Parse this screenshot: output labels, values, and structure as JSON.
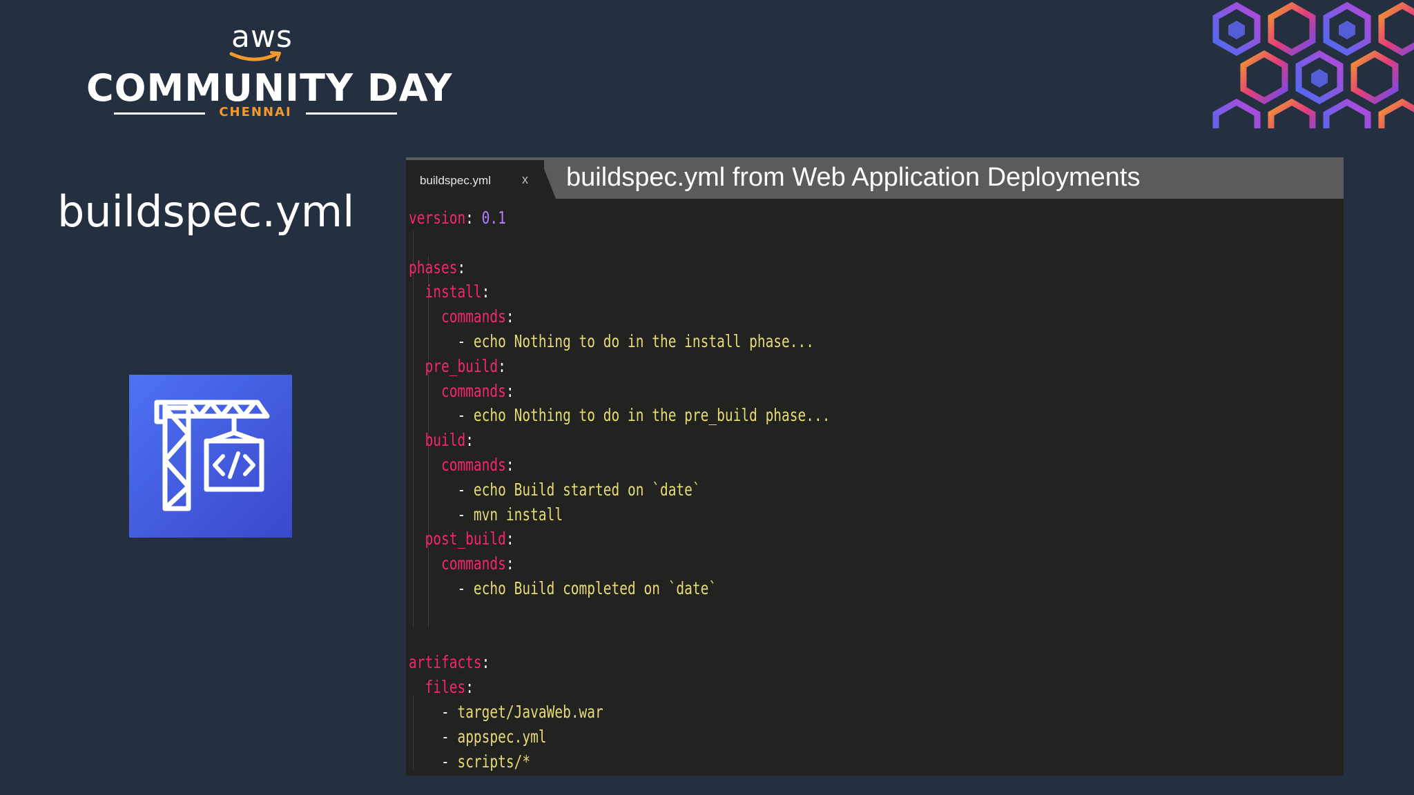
{
  "logo": {
    "aws": "aws",
    "title": "COMMUNITY DAY",
    "city": "CHENNAI"
  },
  "slide_title": "buildspec.yml",
  "service_icon": "codebuild-crane-icon",
  "editor": {
    "tab_label": "buildspec.yml",
    "tab_close": "x",
    "banner": "buildspec.yml from Web Application Deployments",
    "colors": {
      "key": "#f7266c",
      "number": "#ae81ff",
      "string": "#e6db74",
      "punct": "#f8f8f2",
      "background": "#222221"
    },
    "lines": [
      {
        "indent": "",
        "key": "version",
        "sep": ": ",
        "num": "0.1"
      },
      {
        "indent": ""
      },
      {
        "indent": "",
        "key": "phases",
        "sep": ":"
      },
      {
        "indent": "  ",
        "key": "install",
        "sep": ":"
      },
      {
        "indent": "    ",
        "key": "commands",
        "sep": ":"
      },
      {
        "indent": "      ",
        "dash": "- ",
        "val": "echo Nothing to do in the install phase..."
      },
      {
        "indent": "  ",
        "key": "pre_build",
        "sep": ":"
      },
      {
        "indent": "    ",
        "key": "commands",
        "sep": ":"
      },
      {
        "indent": "      ",
        "dash": "- ",
        "val": "echo Nothing to do in the pre_build phase..."
      },
      {
        "indent": "  ",
        "key": "build",
        "sep": ":"
      },
      {
        "indent": "    ",
        "key": "commands",
        "sep": ":"
      },
      {
        "indent": "      ",
        "dash": "- ",
        "val": "echo Build started on `date`"
      },
      {
        "indent": "      ",
        "dash": "- ",
        "val": "mvn install"
      },
      {
        "indent": "  ",
        "key": "post_build",
        "sep": ":"
      },
      {
        "indent": "    ",
        "key": "commands",
        "sep": ":"
      },
      {
        "indent": "      ",
        "dash": "- ",
        "val": "echo Build completed on `date`"
      },
      {
        "indent": ""
      },
      {
        "indent": ""
      },
      {
        "indent": "",
        "key": "artifacts",
        "sep": ":"
      },
      {
        "indent": "  ",
        "key": "files",
        "sep": ":"
      },
      {
        "indent": "    ",
        "dash": "- ",
        "val": "target/JavaWeb.war"
      },
      {
        "indent": "    ",
        "dash": "- ",
        "val": "appspec.yml"
      },
      {
        "indent": "    ",
        "dash": "- ",
        "val": "scripts/*"
      }
    ]
  }
}
